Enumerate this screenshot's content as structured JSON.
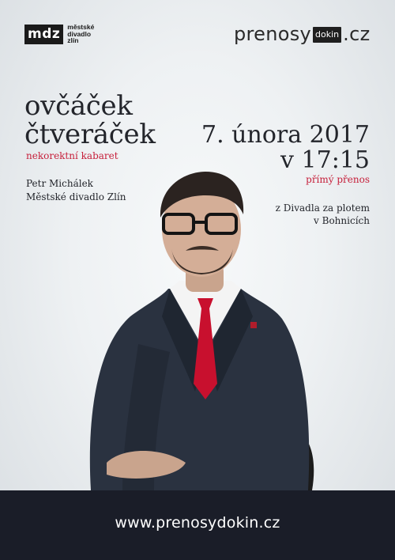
{
  "logos": {
    "mdz": {
      "mark": "mdz",
      "lines": [
        "městské",
        "divadlo",
        "zlín"
      ]
    },
    "prenosy": {
      "word": "prenosy",
      "box": "dokin",
      "suffix": ".cz"
    }
  },
  "show": {
    "title_line1": "ovčáček",
    "title_line2": "čtveráček",
    "subtitle": "nekorektní kabaret",
    "author": "Petr Michálek",
    "theatre": "Městské divadlo Zlín"
  },
  "event": {
    "date": "7. února 2017",
    "time": "v 17:15",
    "broadcast": "přímý přenos",
    "venue_line1": "z Divadla za plotem",
    "venue_line2": "v Bohnicích"
  },
  "footer": {
    "url": "www.prenosydokin.cz"
  },
  "colors": {
    "accent": "#c61f3a",
    "footer_bg": "#1a1d28",
    "text": "#23252b"
  },
  "photo": {
    "subject": "man-in-suit-with-red-tie-seated"
  }
}
